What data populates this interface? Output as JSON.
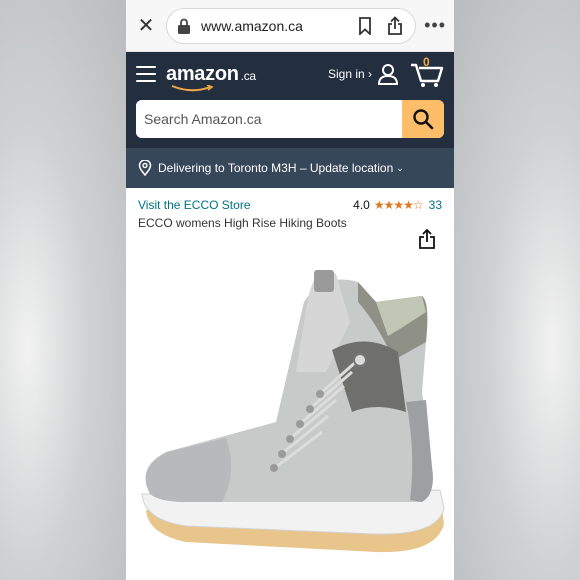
{
  "browser": {
    "url": "www.amazon.ca",
    "icons": [
      "close-icon",
      "lock-icon",
      "bookmark-icon",
      "share-icon",
      "more-icon"
    ]
  },
  "header": {
    "logo": "amazon",
    "logo_tld": ".ca",
    "signin_label": "Sign in ›",
    "cart_count": "0"
  },
  "search": {
    "placeholder": "Search Amazon.ca"
  },
  "delivery": {
    "text": "Delivering to Toronto M3H – Update location",
    "chevron": "⌄"
  },
  "product": {
    "store_link": "Visit the ECCO Store",
    "rating_value": "4.0",
    "stars": "★★★★☆",
    "rating_count": "33",
    "title": "ECCO womens High Rise Hiking Boots"
  },
  "colors": {
    "header_bg": "#232f3e",
    "delivery_bg": "#37475a",
    "search_button": "#febd69",
    "link": "#007185",
    "star": "#de7921"
  }
}
